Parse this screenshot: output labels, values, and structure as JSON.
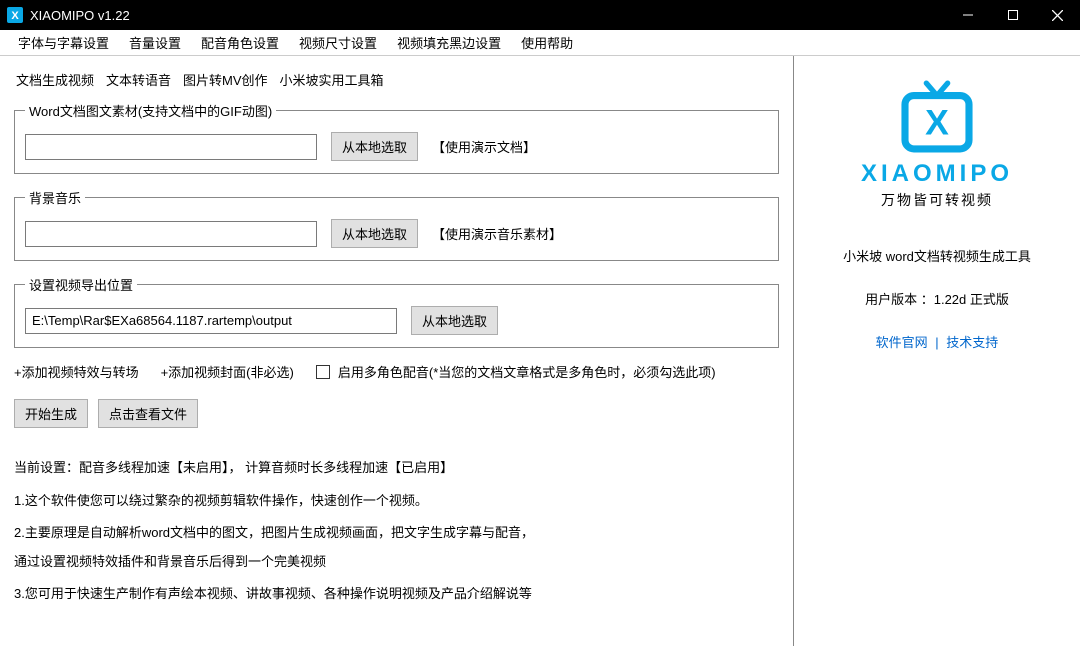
{
  "titlebar": {
    "title": "XIAOMIPO v1.22"
  },
  "menu": {
    "items": [
      "字体与字幕设置",
      "音量设置",
      "配音角色设置",
      "视频尺寸设置",
      "视频填充黑边设置",
      "使用帮助"
    ]
  },
  "tabs": [
    "文档生成视频",
    "文本转语音",
    "图片转MV创作",
    "小米坡实用工具箱"
  ],
  "group1": {
    "legend": "Word文档图文素材(支持文档中的GIF动图)",
    "value": "",
    "browse": "从本地选取",
    "hint": "【使用演示文档】"
  },
  "group2": {
    "legend": "背景音乐",
    "value": "",
    "browse": "从本地选取",
    "hint": "【使用演示音乐素材】"
  },
  "group3": {
    "legend": "设置视频导出位置",
    "value": "E:\\Temp\\Rar$EXa68564.1187.rartemp\\output",
    "browse": "从本地选取"
  },
  "options": {
    "add_effects": "+添加视频特效与转场",
    "add_cover": "+添加视频封面(非必选)",
    "multirole_checked": false,
    "multirole_label": "启用多角色配音(*当您的文档文章格式是多角色时，必须勾选此项)"
  },
  "actions": {
    "generate": "开始生成",
    "view": "点击查看文件"
  },
  "info": {
    "status": "当前设置：配音多线程加速【未启用】，  计算音频时长多线程加速【已启用】",
    "line1": "1.这个软件使您可以绕过繁杂的视频剪辑软件操作，快速创作一个视频。",
    "line2a": "2.主要原理是自动解析word文档中的图文，把图片生成视频画面，把文字生成字幕与配音，",
    "line2b": "通过设置视频特效插件和背景音乐后得到一个完美视频",
    "line3": "3.您可用于快速生产制作有声绘本视频、讲故事视频、各种操作说明视频及产品介绍解说等"
  },
  "right": {
    "brand": "XIAOMIPO",
    "slogan": "万物皆可转视频",
    "desc": "小米坡 word文档转视频生成工具",
    "version": "用户版本 ：1.22d 正式版",
    "link1": "软件官网",
    "sep": " | ",
    "link2": "技术支持"
  }
}
